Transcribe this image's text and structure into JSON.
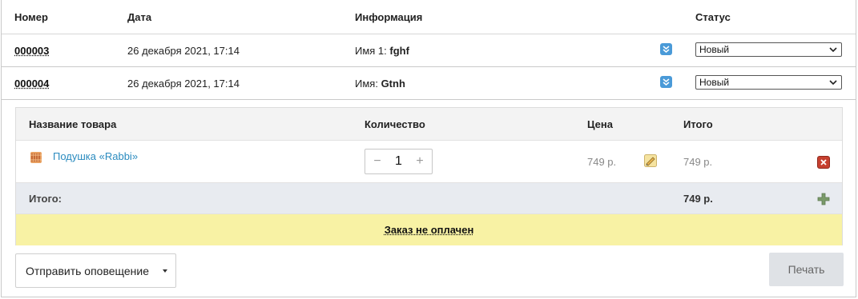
{
  "orders": {
    "headers": {
      "number": "Номер",
      "date": "Дата",
      "info": "Информация",
      "status": "Статус"
    },
    "rows": [
      {
        "number": "000003",
        "date": "26 декабря 2021, 17:14",
        "info_label": "Имя 1:",
        "info_value": "fghf",
        "status": "Новый"
      },
      {
        "number": "000004",
        "date": "26 декабря 2021, 17:14",
        "info_label": "Имя:",
        "info_value": "Gtnh",
        "status": "Новый"
      }
    ]
  },
  "goods": {
    "headers": {
      "name": "Название товара",
      "qty": "Количество",
      "price": "Цена",
      "total": "Итого"
    },
    "items": [
      {
        "name": "Подушка «Rabbi»",
        "qty": "1",
        "price": "749 р.",
        "total": "749 р."
      }
    ],
    "summary_label": "Итого:",
    "summary_total": "749 р.",
    "payment_status": "Заказ не оплачен"
  },
  "actions": {
    "notify_label": "Отправить оповещение",
    "print_label": "Печать"
  },
  "colors": {
    "link": "#2a8bbf",
    "unpaid_bg": "#f8f2a4",
    "remove": "#c6402f",
    "expand": "#4a9ad8"
  }
}
